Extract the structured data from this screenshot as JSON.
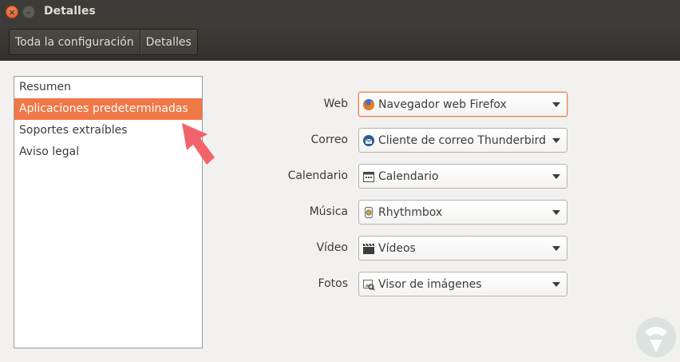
{
  "window": {
    "title": "Detalles",
    "close_glyph": "×",
    "minimize_glyph": "–"
  },
  "toolbar": {
    "crumbs": [
      "Toda la configuración",
      "Detalles"
    ]
  },
  "sidebar": {
    "items": [
      {
        "label": "Resumen",
        "selected": false
      },
      {
        "label": "Aplicaciones predeterminadas",
        "selected": true
      },
      {
        "label": "Soportes extraíbles",
        "selected": false
      },
      {
        "label": "Aviso legal",
        "selected": false
      }
    ]
  },
  "defaults": {
    "rows": [
      {
        "label": "Web",
        "value": "Navegador web Firefox",
        "icon": "firefox-icon"
      },
      {
        "label": "Correo",
        "value": "Cliente de correo Thunderbird",
        "icon": "thunderbird-icon"
      },
      {
        "label": "Calendario",
        "value": "Calendario",
        "icon": "calendar-icon"
      },
      {
        "label": "Música",
        "value": "Rhythmbox",
        "icon": "rhythmbox-icon"
      },
      {
        "label": "Vídeo",
        "value": "Vídeos",
        "icon": "videos-icon"
      },
      {
        "label": "Fotos",
        "value": "Visor de imágenes",
        "icon": "image-viewer-icon"
      }
    ]
  },
  "colors": {
    "accent": "#f07746",
    "titlebar": "#3c3b37",
    "arrow": "#f2636b"
  }
}
